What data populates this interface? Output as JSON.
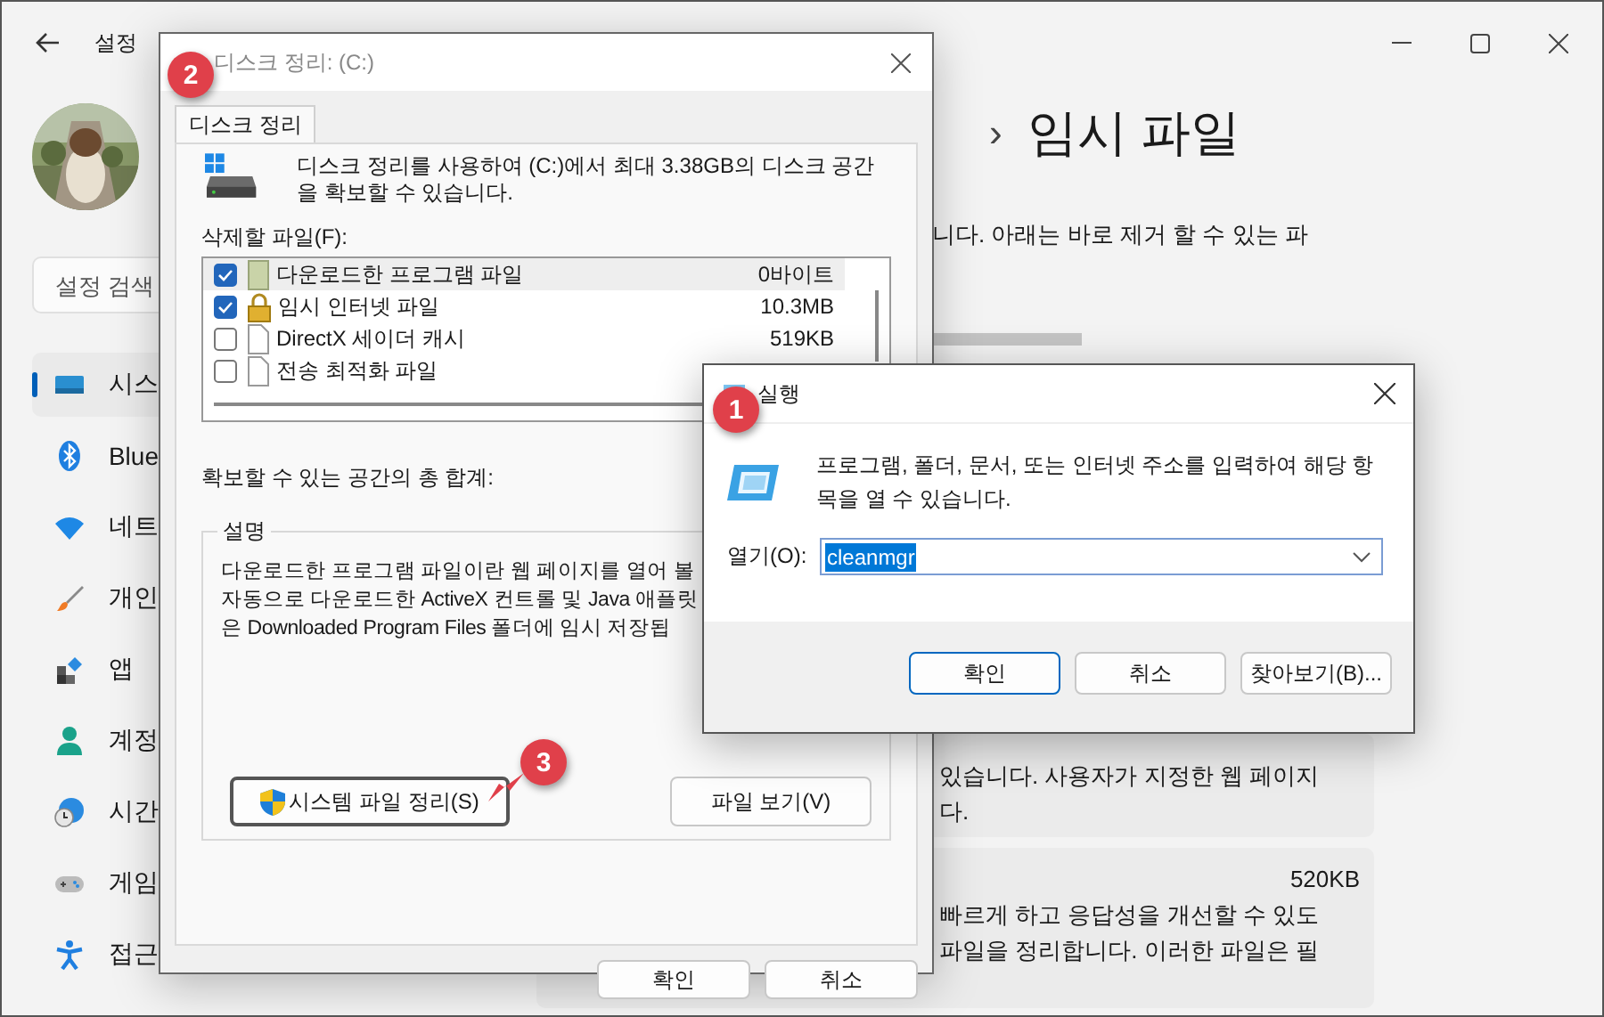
{
  "settings": {
    "title": "설정",
    "search": {
      "placeholder": "설정 검색"
    },
    "nav": [
      {
        "kind": "system",
        "label": "시스",
        "selected": true
      },
      {
        "kind": "bluetooth",
        "label": "Blue",
        "selected": false
      },
      {
        "kind": "network",
        "label": "네트",
        "selected": false
      },
      {
        "kind": "personalize",
        "label": "개인",
        "selected": false
      },
      {
        "kind": "apps",
        "label": "앱",
        "selected": false
      },
      {
        "kind": "accounts",
        "label": "계정",
        "selected": false
      },
      {
        "kind": "time",
        "label": "시간",
        "selected": false
      },
      {
        "kind": "gaming",
        "label": "게임",
        "selected": false
      },
      {
        "kind": "accessibility",
        "label": "접근",
        "selected": false
      }
    ],
    "breadcrumb": {
      "separator": "›",
      "current": "임시 파일"
    },
    "intro": "니다. 아래는 바로 제거 할 수 있는 파",
    "cards": [
      {
        "lines": [
          "있습니다. 사용자가 지정한 웹 페이지",
          "다."
        ]
      },
      {
        "size": "520KB",
        "lines": [
          "빠르게 하고 응답성을 개선할 수 있도",
          "파일을 정리합니다. 이러한 파일은 필"
        ]
      }
    ]
  },
  "disk_cleanup": {
    "title": "디스크 정리: (C:)",
    "callout": "2",
    "tabs": [
      {
        "label": "디스크 정리",
        "selected": true
      }
    ],
    "intro": "디스크 정리를 사용하여 (C:)에서 최대 3.38GB의 디스크 공간을 확보할 수 있습니다.",
    "files_label": "삭제할 파일(F):",
    "files": [
      {
        "kind": "folder",
        "name": "다운로드한 프로그램 파일",
        "size": "0바이트",
        "checked": true,
        "selected": true
      },
      {
        "kind": "lock",
        "name": "임시 인터넷 파일",
        "size": "10.3MB",
        "checked": true,
        "selected": false
      },
      {
        "kind": "file",
        "name": "DirectX 세이더 캐시",
        "size": "519KB",
        "checked": false,
        "selected": false
      },
      {
        "kind": "file",
        "name": "전송 최적화 파일",
        "checked": false,
        "selected": false
      }
    ],
    "total_label": "확보할 수 있는 공간의 총 합계:",
    "description": {
      "title": "설명",
      "lines": [
        "다운로드한 프로그램 파일이란 웹 페이지를 열어 볼",
        "자동으로 다운로드한 ActiveX 컨트롤 및 Java 애플릿",
        "은 Downloaded Program Files 폴더에 임시 저장됩"
      ]
    },
    "system_button": {
      "label": "시스템 파일 정리(S)",
      "callout": "3"
    },
    "view_button": "파일 보기(V)",
    "buttons": [
      "확인",
      "취소"
    ]
  },
  "run": {
    "title": "실행",
    "callout": "1",
    "message": "프로그램, 폴더, 문서, 또는 인터넷 주소를 입력하여 해당 항목을 열 수 있습니다.",
    "open_label": "열기(O):",
    "value": "cleanmgr",
    "buttons": [
      {
        "label": "확인",
        "focused": true
      },
      {
        "label": "취소",
        "focused": false
      },
      {
        "label": "찾아보기(B)...",
        "focused": false
      }
    ]
  }
}
